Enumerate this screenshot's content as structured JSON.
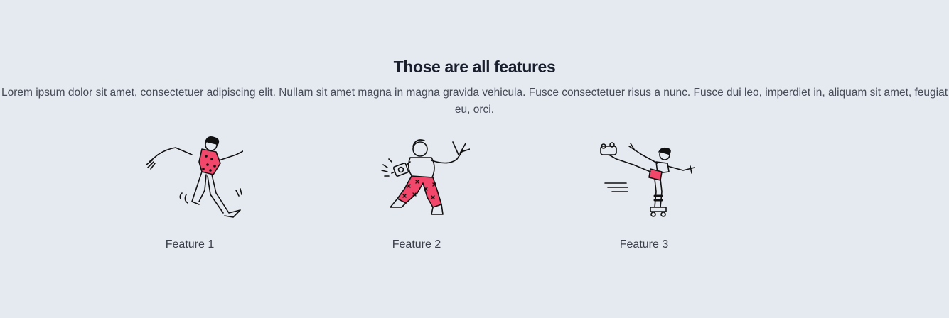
{
  "section": {
    "title": "Those are all features",
    "description": "Lorem ipsum dolor sit amet, consectetuer adipiscing elit. Nullam sit amet magna in magna gravida vehicula. Fusce consectetuer risus a nunc. Fusce dui leo, imperdiet in, aliquam sit amet, feugiat eu, orci."
  },
  "features": [
    {
      "label": "Feature 1",
      "illustration": "running-person-illustration"
    },
    {
      "label": "Feature 2",
      "illustration": "dancing-person-illustration"
    },
    {
      "label": "Feature 3",
      "illustration": "roller-skater-illustration"
    }
  ],
  "colors": {
    "background": "#e5e9f0",
    "accent": "#f2476a",
    "ink": "#111111"
  }
}
